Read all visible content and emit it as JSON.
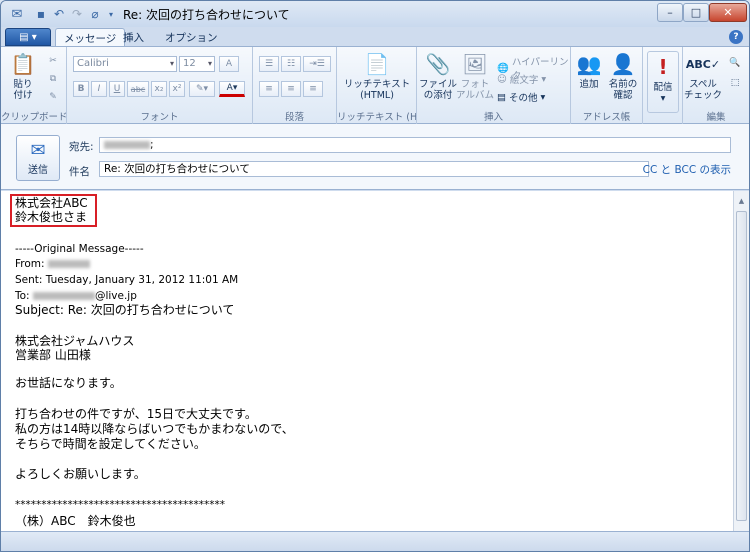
{
  "window": {
    "title": "Re: 次回の打ち合わせについて",
    "min": "–",
    "max": "□",
    "close": "✕"
  },
  "tabs": {
    "app_menu": "▤ ▾",
    "items": [
      "メッセージ",
      "挿入",
      "オプション"
    ],
    "active": "メッセージ",
    "help": "?"
  },
  "ribbon": {
    "clipboard": {
      "paste": "貼り付け",
      "label": "クリップボード"
    },
    "font": {
      "font_name": "Calibri",
      "font_size": "12",
      "bold": "B",
      "italic": "I",
      "underline": "U",
      "strike": "abc",
      "subscript": "x₂",
      "superscript": "x²",
      "font_color": "A",
      "label": "フォント"
    },
    "paragraph": {
      "label": "段落"
    },
    "richtext": {
      "button": "リッチテキスト\n(HTML)",
      "label": "リッチテキスト (H..."
    },
    "insert": {
      "attach": "ファイル\nの添付",
      "photo": "フォト\nアルバム",
      "hyperlink": "ハイパーリンク",
      "emoticon": "絵文字",
      "other": "その他",
      "label": "挿入"
    },
    "addressbook": {
      "add": "追加",
      "check": "名前の\n確認",
      "label": "アドレス帳"
    },
    "delivery": {
      "priority": "配信"
    },
    "edit": {
      "spell": "スペル\nチェック",
      "label": "編集"
    }
  },
  "header": {
    "send": "送信",
    "to_label": "宛先:",
    "to_suffix": ";",
    "subject_label": "件名",
    "subject_value": "Re: 次回の打ち合わせについて",
    "cc_bcc": "CC と BCC の表示"
  },
  "body": {
    "l1": "株式会社ABC",
    "l2": "鈴木俊也さま",
    "orig": "-----Original Message-----",
    "from": "From:",
    "sent": "Sent: Tuesday, January 31, 2012 11:01 AM",
    "to": "To:",
    "to_domain": "@live.jp",
    "subject": "Subject: Re: 次回の打ち合わせについて",
    "p1a": "株式会社ジャムハウス",
    "p1b": "営業部 山田様",
    "p2": "お世話になります。",
    "p3a": "打ち合わせの件ですが、15日で大丈夫です。",
    "p3b": "私の方は14時以降ならばいつでもかまわないので、",
    "p3c": "そちらで時間を設定してください。",
    "p4": "よろしくお願いします。",
    "stars": "****************************************",
    "sig": "（株）ABC　鈴木俊也"
  },
  "colors": {
    "highlight": "#d81f26",
    "accent": "#1f56a4"
  }
}
